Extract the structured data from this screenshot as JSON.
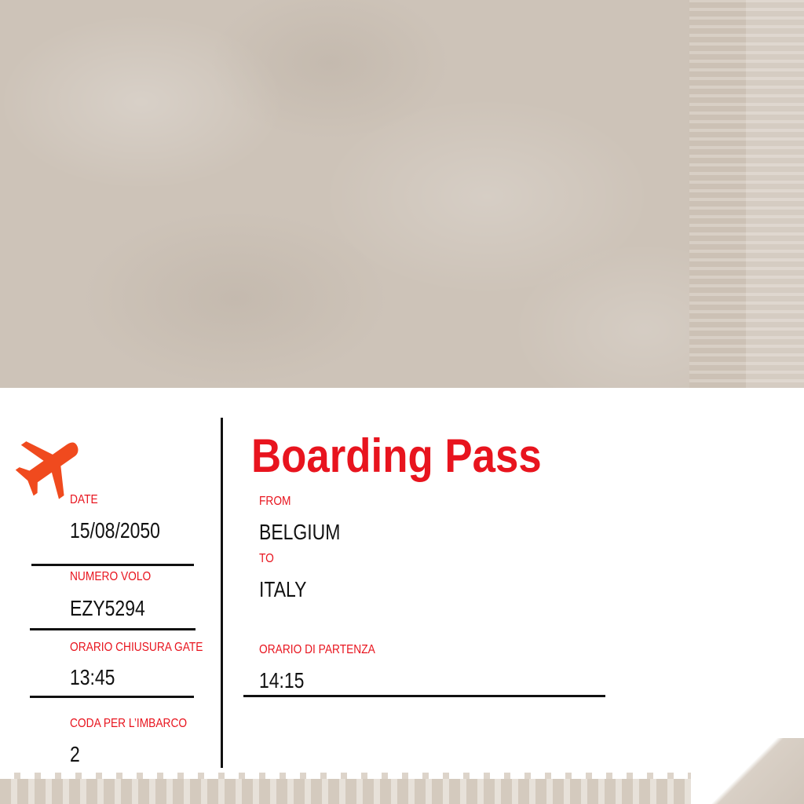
{
  "title": "Boarding Pass",
  "left_fields": [
    {
      "label": "DATE",
      "value": "15/08/2050"
    },
    {
      "label": "NUMERO VOLO",
      "value": "EZY5294"
    },
    {
      "label": "ORARIO CHIUSURA GATE",
      "value": "13:45"
    },
    {
      "label": "CODA PER L’IMBARCO",
      "value": "2"
    }
  ],
  "right_fields": {
    "from_label": "FROM",
    "from_value": "BELGIUM",
    "to_label": "TO",
    "to_value": "ITALY",
    "departure_label": "ORARIO DI PARTENZA",
    "departure_value": "14:15"
  },
  "icons": {
    "plane": "airplane-icon"
  },
  "colors": {
    "accent": "#e8141e",
    "icon": "#f04a1e",
    "text": "#111111",
    "background": "#cdc3b8"
  }
}
